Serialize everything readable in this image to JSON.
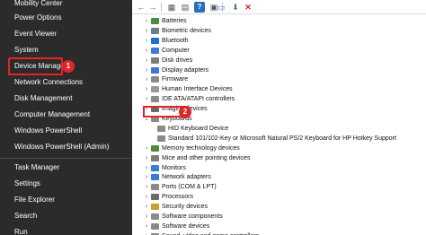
{
  "menu": {
    "items": [
      {
        "label": "Mobility Center"
      },
      {
        "label": "Power Options"
      },
      {
        "label": "Event Viewer"
      },
      {
        "label": "System"
      },
      {
        "label": "Device Manager",
        "highlighted": true,
        "step": "1"
      },
      {
        "label": "Network Connections"
      },
      {
        "label": "Disk Management"
      },
      {
        "label": "Computer Management"
      },
      {
        "label": "Windows PowerShell"
      },
      {
        "label": "Windows PowerShell (Admin)"
      },
      {
        "label": "Task Manager"
      },
      {
        "label": "Settings"
      },
      {
        "label": "File Explorer"
      },
      {
        "label": "Search"
      },
      {
        "label": "Run"
      }
    ]
  },
  "toolbar": {
    "buttons": [
      {
        "icon": "back-arrow-icon",
        "glyph": "←"
      },
      {
        "icon": "forward-arrow-icon",
        "glyph": "→"
      },
      {
        "icon": "show-hide-console-tree-icon",
        "glyph": "▦"
      },
      {
        "icon": "properties-icon",
        "glyph": "▤"
      },
      {
        "icon": "help-icon",
        "glyph": "?"
      },
      {
        "icon": "update-driver-icon",
        "glyph": "▣"
      },
      {
        "icon": "scan-hardware-changes-icon",
        "glyph": "▭"
      },
      {
        "icon": "disable-device-icon",
        "glyph": "⬇"
      },
      {
        "icon": "uninstall-device-icon",
        "glyph": "✕"
      }
    ]
  },
  "tree": {
    "nodes": [
      {
        "label": "Batteries",
        "icon": "battery-icon",
        "color": "#4c8a3c"
      },
      {
        "label": "Biometric devices",
        "icon": "biometric-icon",
        "color": "#6b7b8c"
      },
      {
        "label": "Bluetooth",
        "icon": "bluetooth-icon",
        "color": "#1f6fd0"
      },
      {
        "label": "Computer",
        "icon": "computer-icon",
        "color": "#3a7bd5"
      },
      {
        "label": "Disk drives",
        "icon": "disk-drive-icon",
        "color": "#7d7d7d"
      },
      {
        "label": "Display adapters",
        "icon": "display-adapter-icon",
        "color": "#3a7bd5"
      },
      {
        "label": "Firmware",
        "icon": "firmware-icon",
        "color": "#8a8a8a"
      },
      {
        "label": "Human Interface Devices",
        "icon": "hid-icon",
        "color": "#9a9a9a"
      },
      {
        "label": "IDE ATA/ATAPI controllers",
        "icon": "ide-controller-icon",
        "color": "#8a8a8a"
      },
      {
        "label": "Imaging devices",
        "icon": "imaging-device-icon",
        "color": "#6b6b6b"
      },
      {
        "label": "Keyboards",
        "icon": "keyboard-icon",
        "color": "#8a8a8a",
        "expanded": true,
        "step": "2"
      },
      {
        "label": "HID Keyboard Device",
        "icon": "keyboard-icon",
        "color": "#8a8a8a",
        "child": true
      },
      {
        "label": "Standard 101/102-Key or Microsoft Natural PS/2 Keyboard for HP Hotkey Support",
        "icon": "keyboard-icon",
        "color": "#8a8a8a",
        "child": true
      },
      {
        "label": "Memory technology devices",
        "icon": "memory-icon",
        "color": "#4c8a3c"
      },
      {
        "label": "Mice and other pointing devices",
        "icon": "mouse-icon",
        "color": "#7d7d7d"
      },
      {
        "label": "Monitors",
        "icon": "monitor-icon",
        "color": "#3a7bd5"
      },
      {
        "label": "Network adapters",
        "icon": "network-adapter-icon",
        "color": "#3a7bd5"
      },
      {
        "label": "Ports (COM & LPT)",
        "icon": "port-icon",
        "color": "#8a8a8a"
      },
      {
        "label": "Processors",
        "icon": "processor-icon",
        "color": "#6b6b6b"
      },
      {
        "label": "Security devices",
        "icon": "security-device-icon",
        "color": "#c9a227"
      },
      {
        "label": "Software components",
        "icon": "software-component-icon",
        "color": "#8a8a8a"
      },
      {
        "label": "Software devices",
        "icon": "software-device-icon",
        "color": "#8a8a8a"
      },
      {
        "label": "Sound, video and game controllers",
        "icon": "sound-icon",
        "color": "#8a8a8a"
      }
    ]
  }
}
